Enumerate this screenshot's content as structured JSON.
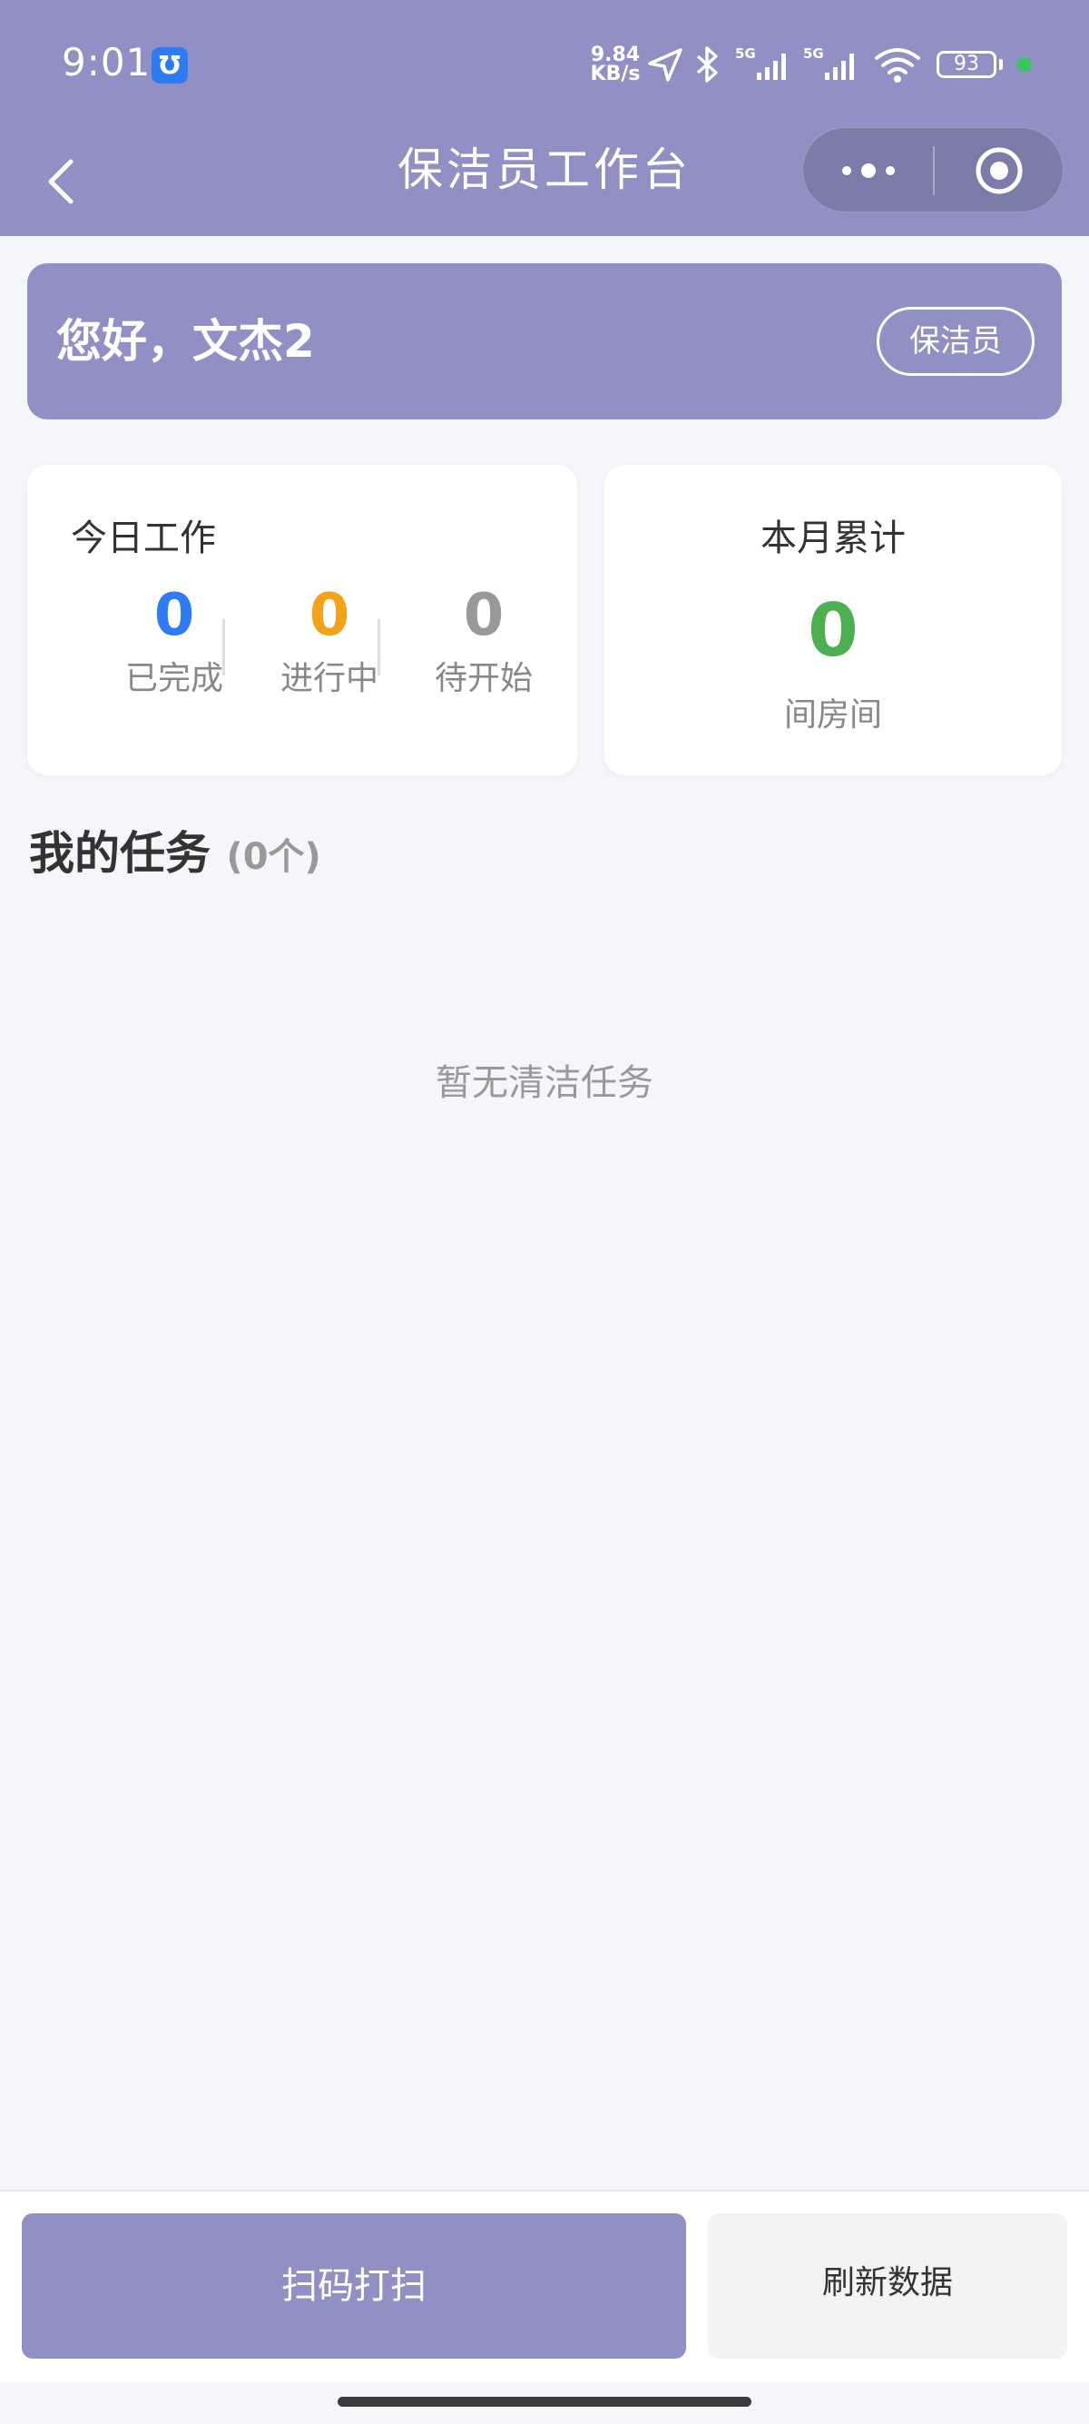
{
  "status_bar": {
    "time": "9:01",
    "app_badge": "Ʊ",
    "net_speed_value": "9.84",
    "net_speed_unit": "KB/s",
    "battery": "93",
    "icons": [
      "location-arrow-icon",
      "bluetooth-icon",
      "signal-5g-icon",
      "signal-5g-icon",
      "wifi-icon"
    ]
  },
  "nav": {
    "title": "保洁员工作台",
    "back_icon": "chevron-left-icon",
    "more_icon": "more-dots-icon",
    "close_icon": "target-circle-icon"
  },
  "greeting": {
    "text": "您好，文杰2",
    "role": "保洁员"
  },
  "today_work": {
    "title": "今日工作",
    "stats": [
      {
        "value": "0",
        "label": "已完成",
        "color": "#2e7cf6"
      },
      {
        "value": "0",
        "label": "进行中",
        "color": "#f5a21b"
      },
      {
        "value": "0",
        "label": "待开始",
        "color": "#999999"
      }
    ]
  },
  "month_total": {
    "title": "本月累计",
    "value": "0",
    "label": "间房间",
    "color": "#4caf50"
  },
  "tasks": {
    "heading": "我的任务",
    "count": "(0个)",
    "empty_text": "暂无清洁任务"
  },
  "actions": {
    "scan_label": "扫码打扫",
    "refresh_label": "刷新数据"
  },
  "colors": {
    "theme": "#9190c4",
    "background": "#f5f6fa"
  }
}
